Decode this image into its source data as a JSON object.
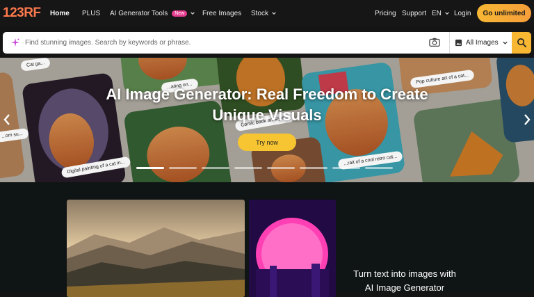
{
  "nav": {
    "logo": "123RF",
    "items": [
      {
        "label": "Home",
        "active": true
      },
      {
        "label": "PLUS"
      },
      {
        "label": "AI Generator Tools",
        "badge": "New"
      },
      {
        "label": "Free Images"
      },
      {
        "label": "Stock"
      }
    ],
    "right": {
      "pricing": "Pricing",
      "support": "Support",
      "lang": "EN",
      "login": "Login",
      "cta": "Go unlimited"
    }
  },
  "search": {
    "placeholder": "Find stunning images. Search by keywords or phrase.",
    "type_selected": "All Images",
    "icons": [
      "sparkle-icon",
      "camera-icon",
      "image-icon",
      "chevron-down-icon",
      "search-icon"
    ]
  },
  "hero": {
    "title": "AI Image Generator: Real Freedom to Create Unique Visuals",
    "cta": "Try now",
    "captions": [
      "Cat ga...",
      "...ating on...",
      "...om su...",
      "Digital painting of a cat in...",
      "Comic book art style...",
      "Pop culture art of a cat...",
      "...rait of a cool retro cat..."
    ],
    "slides_total": 8,
    "slide_active": 1
  },
  "lower": {
    "text_line1": "Turn text into images with",
    "text_line2": "AI Image Generator"
  },
  "colors": {
    "accent": "#f7b733",
    "logo": "#ff7a4d",
    "badge": "#e53d8f",
    "nav_bg": "#161616"
  }
}
